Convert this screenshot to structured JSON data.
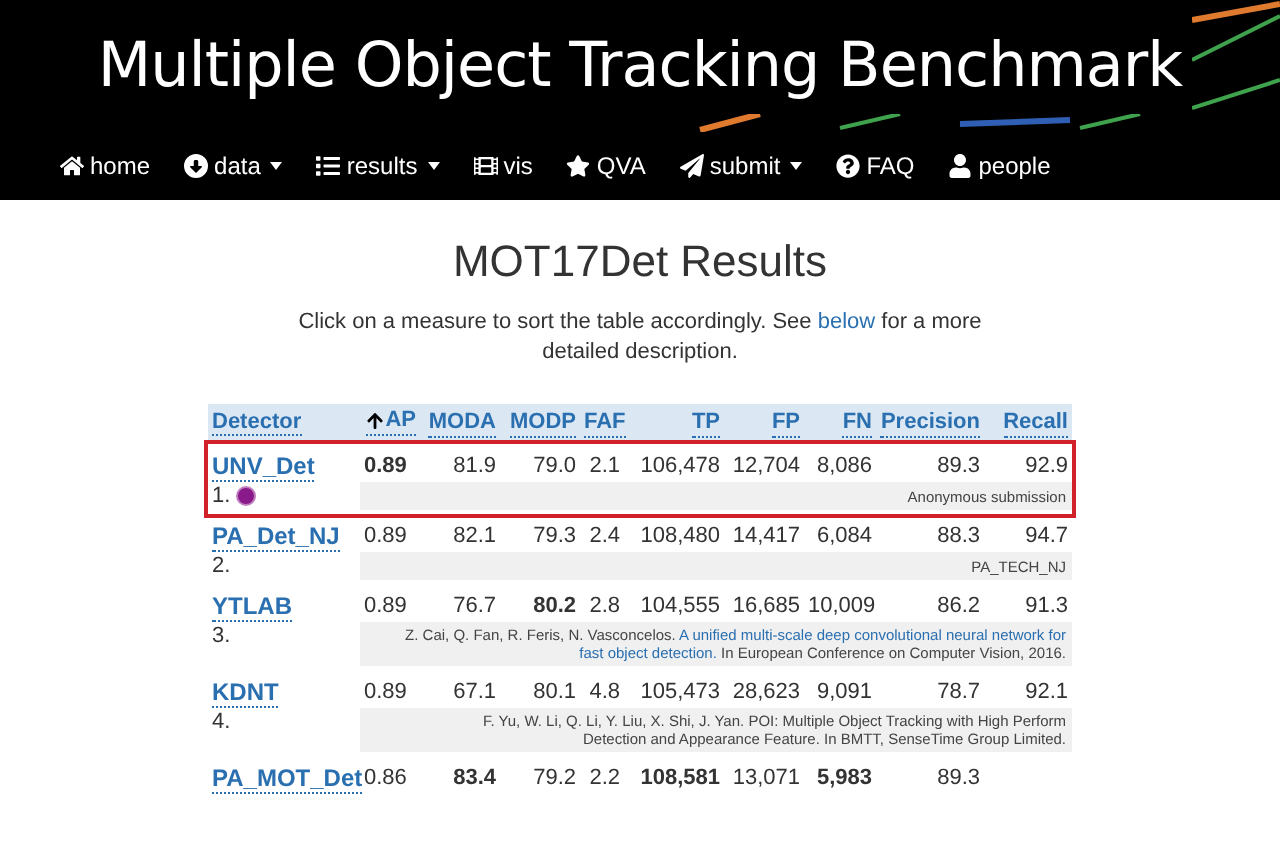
{
  "site_title": "Multiple Object Tracking Benchmark",
  "nav": [
    {
      "label": "home",
      "dropdown": false
    },
    {
      "label": "data",
      "dropdown": true
    },
    {
      "label": "results",
      "dropdown": true
    },
    {
      "label": "vis",
      "dropdown": false
    },
    {
      "label": "QVA",
      "dropdown": false
    },
    {
      "label": "submit",
      "dropdown": true
    },
    {
      "label": "FAQ",
      "dropdown": false
    },
    {
      "label": "people",
      "dropdown": false
    }
  ],
  "page_title": "MOT17Det Results",
  "intro": {
    "before": "Click on a measure to sort the table accordingly. See ",
    "link": "below",
    "after": " for a more detailed description."
  },
  "table": {
    "detector_column": "Detector",
    "columns": [
      {
        "label": "AP",
        "sorted": true
      },
      {
        "label": "MODA",
        "sorted": false
      },
      {
        "label": "MODP",
        "sorted": false
      },
      {
        "label": "FAF",
        "sorted": false
      },
      {
        "label": "TP",
        "sorted": false
      },
      {
        "label": "FP",
        "sorted": false
      },
      {
        "label": "FN",
        "sorted": false
      },
      {
        "label": "Precision",
        "sorted": false
      },
      {
        "label": "Recall",
        "sorted": false
      }
    ],
    "rows": [
      {
        "name": "UNV_Det",
        "rank": "1.",
        "new": true,
        "highlighted": true,
        "cells": [
          {
            "text": "0.89",
            "bold": true
          },
          {
            "text": "81.9",
            "bold": false
          },
          {
            "text": "79.0",
            "bold": false
          },
          {
            "text": "2.1",
            "bold": false
          },
          {
            "text": "106,478",
            "bold": false
          },
          {
            "text": "12,704",
            "bold": false
          },
          {
            "text": "8,086",
            "bold": false
          },
          {
            "text": "89.3",
            "bold": false
          },
          {
            "text": "92.9",
            "bold": false
          }
        ],
        "ref": [
          [
            {
              "text": "Anonymous submission",
              "link": false
            }
          ]
        ]
      },
      {
        "name": "PA_Det_NJ",
        "rank": "2.",
        "highlighted": false,
        "cells": [
          {
            "text": "0.89",
            "bold": false
          },
          {
            "text": "82.1",
            "bold": false
          },
          {
            "text": "79.3",
            "bold": false
          },
          {
            "text": "2.4",
            "bold": false
          },
          {
            "text": "108,480",
            "bold": false
          },
          {
            "text": "14,417",
            "bold": false
          },
          {
            "text": "6,084",
            "bold": false
          },
          {
            "text": "88.3",
            "bold": false
          },
          {
            "text": "94.7",
            "bold": false
          }
        ],
        "ref": [
          [
            {
              "text": "PA_TECH_NJ",
              "link": false
            }
          ]
        ]
      },
      {
        "name": "YTLAB",
        "rank": "3.",
        "highlighted": false,
        "cells": [
          {
            "text": "0.89",
            "bold": false
          },
          {
            "text": "76.7",
            "bold": false
          },
          {
            "text": "80.2",
            "bold": true
          },
          {
            "text": "2.8",
            "bold": false
          },
          {
            "text": "104,555",
            "bold": false
          },
          {
            "text": "16,685",
            "bold": false
          },
          {
            "text": "10,009",
            "bold": false
          },
          {
            "text": "86.2",
            "bold": false
          },
          {
            "text": "91.3",
            "bold": false
          }
        ],
        "ref": [
          [
            {
              "text": "Z. Cai, Q. Fan, R. Feris, N. Vasconcelos. ",
              "link": false
            },
            {
              "text": "A unified multi-scale deep convolutional neural network for",
              "link": true
            }
          ],
          [
            {
              "text": "fast object detection.",
              "link": true
            },
            {
              "text": " In European Conference on Computer Vision, 2016.",
              "link": false
            }
          ]
        ]
      },
      {
        "name": "KDNT",
        "rank": "4.",
        "highlighted": false,
        "cells": [
          {
            "text": "0.89",
            "bold": false
          },
          {
            "text": "67.1",
            "bold": false
          },
          {
            "text": "80.1",
            "bold": false
          },
          {
            "text": "4.8",
            "bold": false
          },
          {
            "text": "105,473",
            "bold": false
          },
          {
            "text": "28,623",
            "bold": false
          },
          {
            "text": "9,091",
            "bold": false
          },
          {
            "text": "78.7",
            "bold": false
          },
          {
            "text": "92.1",
            "bold": false
          }
        ],
        "ref": [
          [
            {
              "text": "F. Yu, W. Li, Q. Li, Y. Liu, X. Shi, J. Yan. POI: Multiple Object Tracking with High Perform",
              "link": false
            }
          ],
          [
            {
              "text": "Detection and Appearance Feature. In BMTT, SenseTime Group Limited.",
              "link": false
            }
          ]
        ]
      },
      {
        "name": "PA_MOT_Det",
        "highlighted": false,
        "cells": [
          {
            "text": "0.86",
            "bold": false
          },
          {
            "text": "83.4",
            "bold": true
          },
          {
            "text": "79.2",
            "bold": false
          },
          {
            "text": "2.2",
            "bold": false
          },
          {
            "text": "108,581",
            "bold": true
          },
          {
            "text": "13,071",
            "bold": false
          },
          {
            "text": "5,983",
            "bold": true
          },
          {
            "text": "89.3",
            "bold": false
          }
        ]
      }
    ]
  }
}
